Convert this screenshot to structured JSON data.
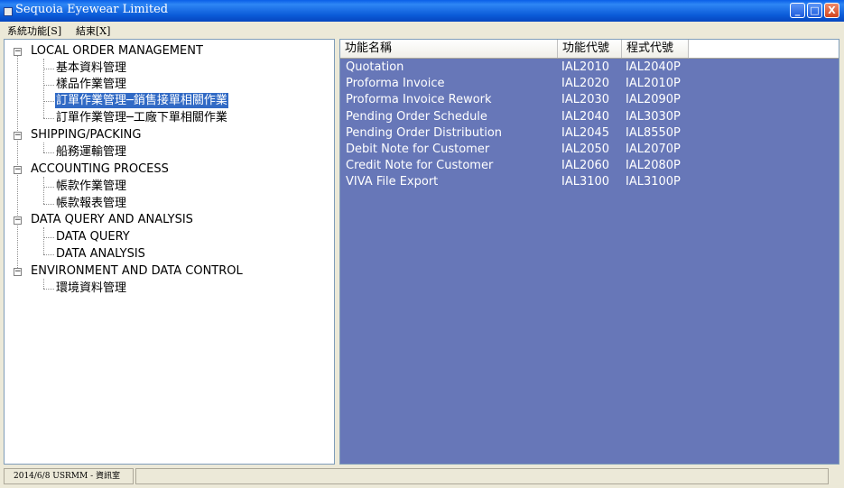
{
  "window": {
    "title": "Sequoia Eyewear Limited",
    "min": "_",
    "max": "□",
    "close": "X"
  },
  "menu": {
    "items": [
      "系統功能[S]",
      "結束[X]"
    ]
  },
  "tree": {
    "groups": [
      {
        "label": "LOCAL ORDER MANAGEMENT",
        "expander": "−",
        "children": [
          "基本資料管理",
          "樣品作業管理",
          "訂單作業管理─銷售接單相關作業",
          "訂單作業管理─工廠下單相關作業"
        ]
      },
      {
        "label": "SHIPPING/PACKING",
        "expander": "−",
        "children": [
          "船務運輸管理"
        ]
      },
      {
        "label": "ACCOUNTING PROCESS",
        "expander": "−",
        "children": [
          "帳款作業管理",
          "帳款報表管理"
        ]
      },
      {
        "label": "DATA QUERY AND ANALYSIS",
        "expander": "−",
        "children": [
          "DATA QUERY",
          "DATA ANALYSIS"
        ]
      },
      {
        "label": "ENVIRONMENT AND DATA CONTROL",
        "expander": "−",
        "children": [
          "環境資料管理"
        ]
      }
    ],
    "selected": "訂單作業管理─銷售接單相關作業"
  },
  "list": {
    "columns": [
      "功能名稱",
      "功能代號",
      "程式代號"
    ],
    "rows": [
      [
        "Quotation",
        "IAL2010",
        "IAL2040P"
      ],
      [
        "Proforma Invoice",
        "IAL2020",
        "IAL2010P"
      ],
      [
        "Proforma Invoice Rework",
        "IAL2030",
        "IAL2090P"
      ],
      [
        "Pending Order Schedule",
        "IAL2040",
        "IAL3030P"
      ],
      [
        "Pending  Order  Distribution",
        "IAL2045",
        "IAL8550P"
      ],
      [
        "Debit Note for Customer",
        "IAL2050",
        "IAL2070P"
      ],
      [
        "Credit Note for Customer",
        "IAL2060",
        "IAL2080P"
      ],
      [
        "VIVA File Export",
        "IAL3100",
        "IAL3100P"
      ]
    ]
  },
  "status": {
    "left": "2014/6/8  USRMM - 資訊室",
    "right": ""
  },
  "colors": {
    "list_background": "#6777B8",
    "selection": "#316AC5",
    "titlebar": "#0A5FE8"
  }
}
